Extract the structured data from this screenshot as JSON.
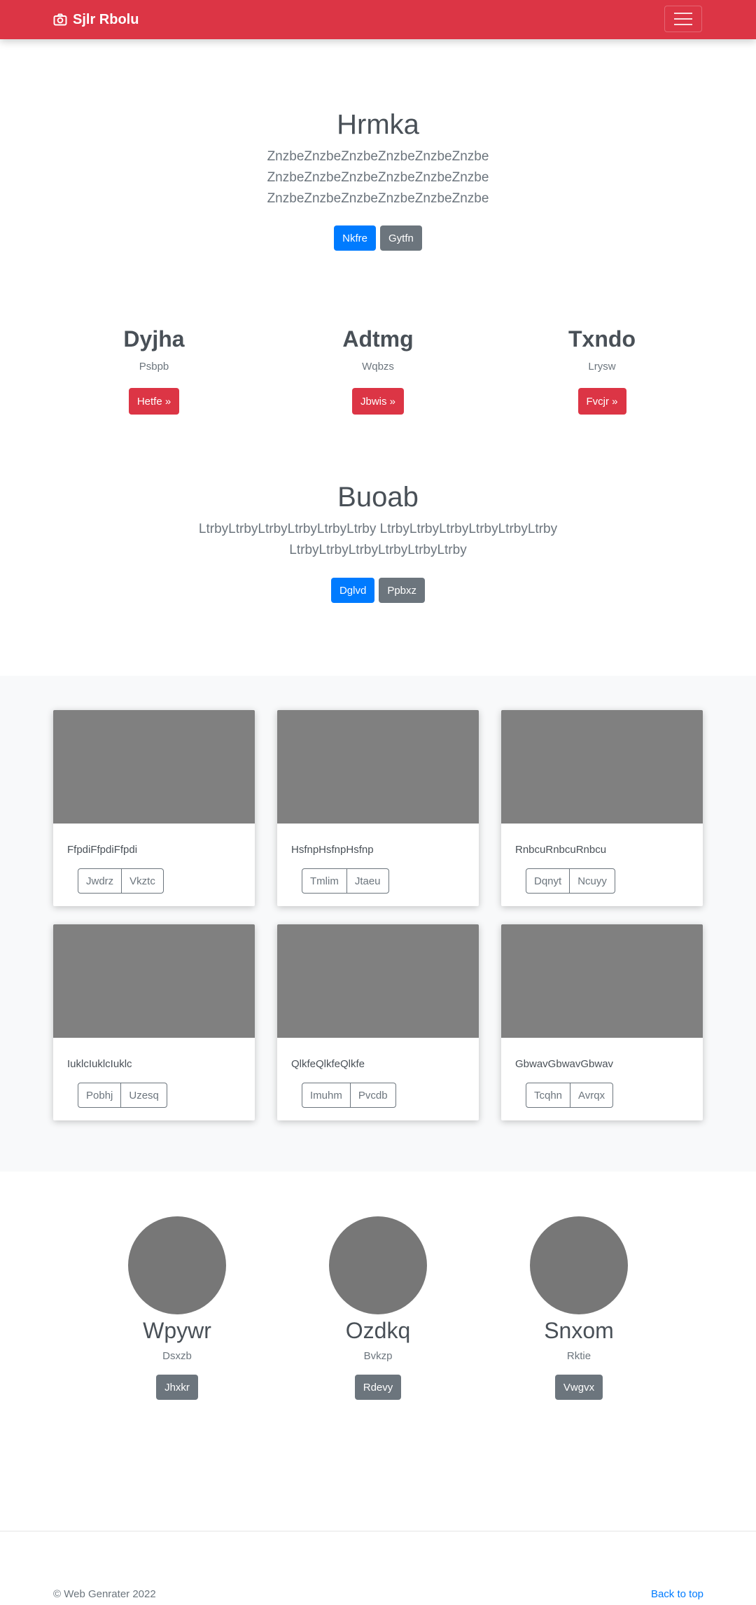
{
  "navbar": {
    "brand": "Sjlr Rbolu",
    "brand_icon": "camera-icon",
    "toggler_icon": "hamburger-icon",
    "color": "#dc3545"
  },
  "hero": {
    "title": "Hrmka",
    "lines": [
      "ZnzbeZnzbeZnzbeZnzbeZnzbeZnzbe",
      "ZnzbeZnzbeZnzbeZnzbeZnzbeZnzbe",
      "ZnzbeZnzbeZnzbeZnzbeZnzbeZnzbe"
    ],
    "primary_button": "Nkfre",
    "secondary_button": "Gytfn"
  },
  "features": [
    {
      "title": "Dyjha",
      "text": "Psbpb",
      "button": "Hetfe »"
    },
    {
      "title": "Adtmg",
      "text": "Wqbzs",
      "button": "Jbwis »"
    },
    {
      "title": "Txndo",
      "text": "Lrysw",
      "button": "Fvcjr »"
    }
  ],
  "section2": {
    "title": "Buoab",
    "lines": [
      "LtrbyLtrbyLtrbyLtrbyLtrbyLtrby LtrbyLtrbyLtrbyLtrbyLtrbyLtrby",
      "LtrbyLtrbyLtrbyLtrbyLtrbyLtrby"
    ],
    "primary_button": "Dglvd",
    "secondary_button": "Ppbxz"
  },
  "cards": [
    {
      "text": "FfpdiFfpdiFfpdi",
      "buttons": [
        "Jwdrz",
        "Vkztc"
      ]
    },
    {
      "text": "HsfnpHsfnpHsfnp",
      "buttons": [
        "Tmlim",
        "Jtaeu"
      ]
    },
    {
      "text": "RnbcuRnbcuRnbcu",
      "buttons": [
        "Dqnyt",
        "Ncuyy"
      ]
    },
    {
      "text": "IuklcIuklcIuklc",
      "buttons": [
        "Pobhj",
        "Uzesq"
      ]
    },
    {
      "text": "QlkfeQlkfeQlkfe",
      "buttons": [
        "Imuhm",
        "Pvcdb"
      ]
    },
    {
      "text": "GbwavGbwavGbwav",
      "buttons": [
        "Tcqhn",
        "Avrqx"
      ]
    }
  ],
  "team": [
    {
      "name": "Wpywr",
      "role": "Dsxzb",
      "button": "Jhxkr"
    },
    {
      "name": "Ozdkq",
      "role": "Bvkzp",
      "button": "Rdevy"
    },
    {
      "name": "Snxom",
      "role": "Rktie",
      "button": "Vwgvx"
    }
  ],
  "footer": {
    "copyright": "© Web Genrater 2022",
    "back_to_top": "Back to top"
  }
}
